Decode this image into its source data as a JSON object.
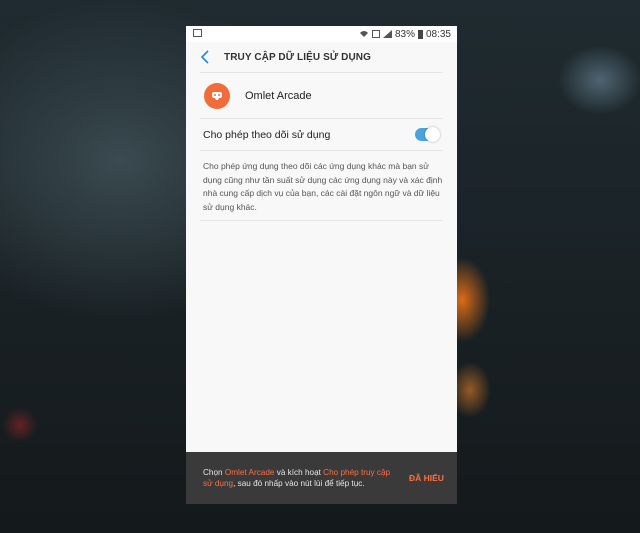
{
  "status_bar": {
    "battery": "83%",
    "time": "08:35"
  },
  "header": {
    "title": "TRUY CẬP DỮ LIỆU SỬ DỤNG"
  },
  "app": {
    "name": "Omlet Arcade",
    "icon_color": "#f26b3a"
  },
  "toggle_row": {
    "label": "Cho phép theo dõi sử dụng",
    "enabled": true,
    "accent": "#4aa3df"
  },
  "description": "Cho phép ứng dụng theo dõi các ứng dụng khác mà bạn sử dụng cũng như tần suất sử dụng các ứng dụng này và xác định nhà cung cấp dịch vụ của bạn, các cài đặt ngôn ngữ và dữ liệu sử dụng khác.",
  "snackbar": {
    "part1": "Chọn ",
    "app_highlight": "Omlet Arcade",
    "part2": " và kích hoạt ",
    "setting_highlight": "Cho phép truy cập sử dụng",
    "part3": ", sau đó nhấp vào nút lùi để tiếp tục.",
    "button": "ĐÃ HIỂU",
    "highlight_color": "#ff6e40"
  }
}
